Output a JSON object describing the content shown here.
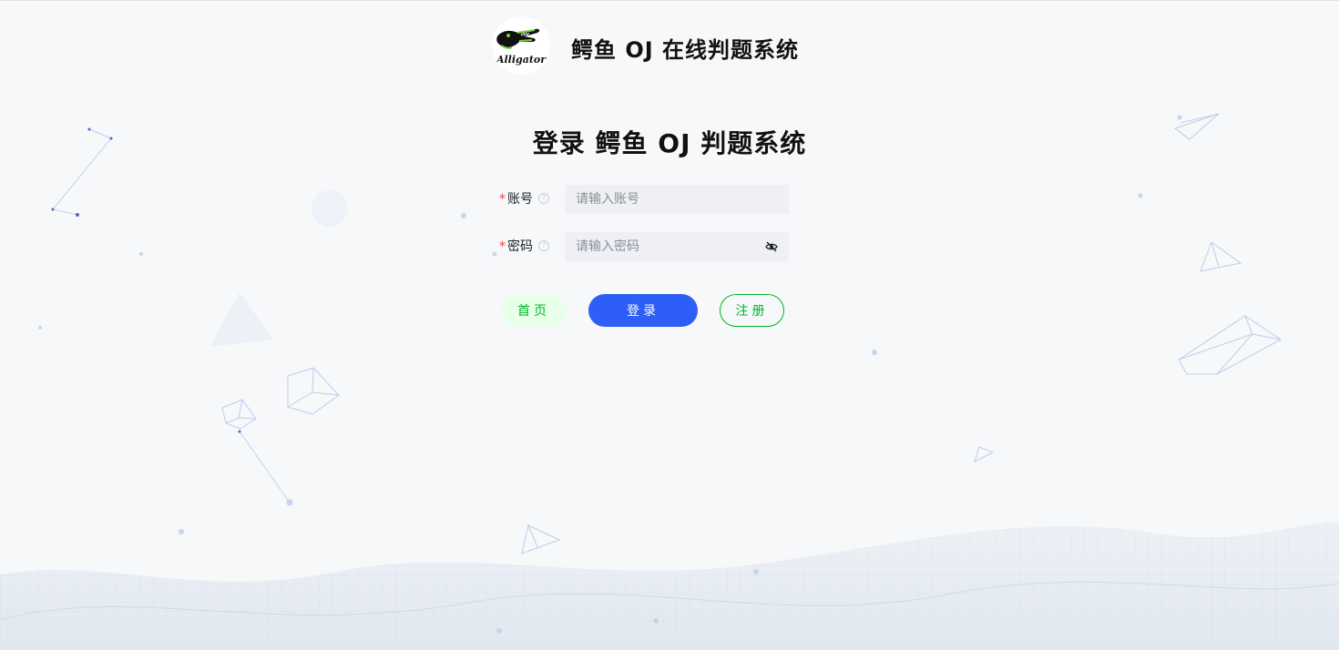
{
  "header": {
    "logo_text": "Alligator",
    "site_title": "鳄鱼 OJ 在线判题系统"
  },
  "form": {
    "title": "登录 鳄鱼 OJ 判题系统",
    "account": {
      "label": "账号",
      "placeholder": "请输入账号",
      "value": ""
    },
    "password": {
      "label": "密码",
      "placeholder": "请输入密码",
      "value": ""
    },
    "required_mark": "*",
    "help_icon": "question-circle-icon",
    "toggle_icon": "eye-invisible-icon"
  },
  "buttons": {
    "home": "首页",
    "login": "登录",
    "register": "注册"
  },
  "colors": {
    "primary": "#2d5ef5",
    "success": "#00b42a",
    "success_light": "#e8ffea",
    "danger": "#f53f3f",
    "input_bg": "#eff0f3",
    "page_bg": "#f7f8fa"
  }
}
